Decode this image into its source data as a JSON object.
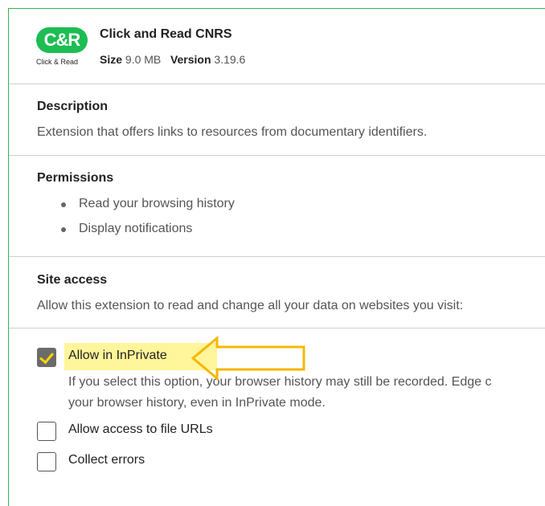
{
  "extension": {
    "name": "Click and Read CNRS",
    "logo_badge": "C&R",
    "logo_sub": "Click & Read",
    "size_label": "Size",
    "size_value": "9.0 MB",
    "version_label": "Version",
    "version_value": "3.19.6"
  },
  "description": {
    "title": "Description",
    "text": "Extension that offers links to resources from documentary identifiers."
  },
  "permissions": {
    "title": "Permissions",
    "items": [
      "Read your browsing history",
      "Display notifications"
    ]
  },
  "site_access": {
    "title": "Site access",
    "text": "Allow this extension to read and change all your data on websites you visit:"
  },
  "options": {
    "inprivate": {
      "label": "Allow in InPrivate",
      "checked": true,
      "desc_line1": "If you select this option, your browser history may still be recorded. Edge c",
      "desc_line2": "your browser history, even in InPrivate mode."
    },
    "file_urls": {
      "label": "Allow access to file URLs",
      "checked": false
    },
    "collect_errors": {
      "label": "Collect errors",
      "checked": false
    }
  },
  "colors": {
    "accent_green": "#1dbd53",
    "highlight_yellow": "#fff59a",
    "arrow_orange": "#f5b700"
  }
}
